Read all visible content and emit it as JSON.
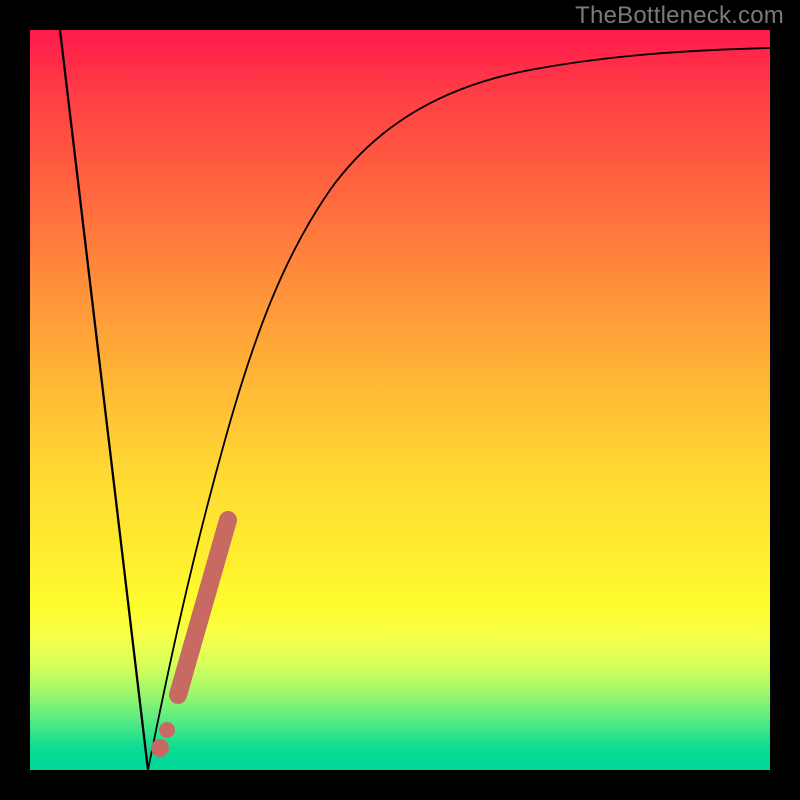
{
  "watermark": "TheBottleneck.com",
  "colors": {
    "background": "#000000",
    "gradient_top": "#ff1a4b",
    "gradient_bottom": "#00d79a",
    "curve": "#000000",
    "marker": "#c76b62"
  },
  "chart_data": {
    "type": "line",
    "title": "",
    "xlabel": "",
    "ylabel": "",
    "xlim": [
      0,
      100
    ],
    "ylim": [
      0,
      100
    ],
    "series": [
      {
        "name": "bottleneck-curve",
        "x": [
          4,
          6,
          8,
          10,
          12,
          14,
          15,
          16,
          18,
          20,
          24,
          30,
          38,
          48,
          60,
          75,
          90,
          100
        ],
        "y": [
          100,
          84,
          67,
          50,
          34,
          15,
          5,
          0,
          9,
          22,
          43,
          61,
          74,
          82,
          87,
          90,
          91.5,
          92
        ]
      }
    ],
    "annotations": [
      {
        "name": "highlighted-segment",
        "x_start": 18,
        "x_end": 26,
        "description": "salmon highlighted region on curve"
      },
      {
        "name": "highlighted-dot",
        "x": 16.5,
        "y": 2
      }
    ]
  }
}
